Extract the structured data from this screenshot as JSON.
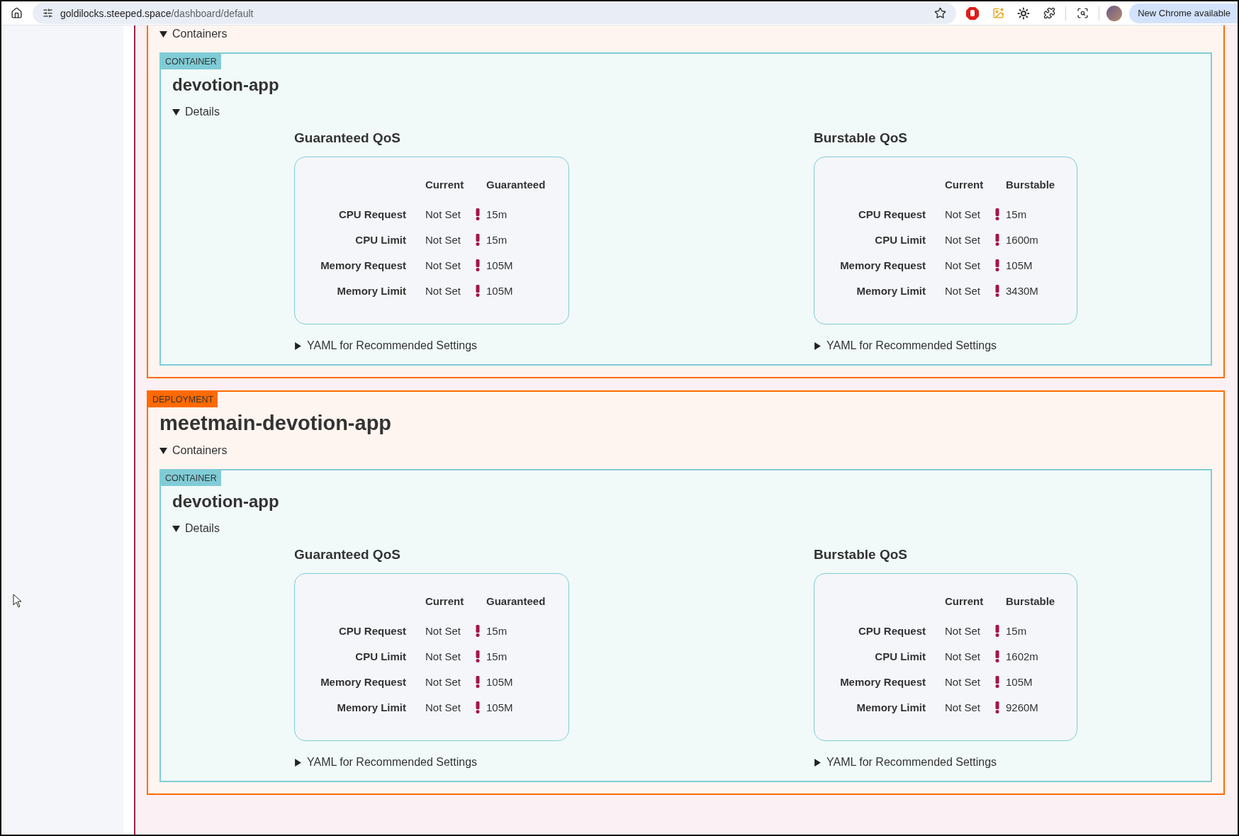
{
  "browser": {
    "url_host": "goldilocks.steeped.space",
    "url_path": "/dashboard/default",
    "update_label": "New Chrome available"
  },
  "deployments": [
    {
      "containers_toggle": {
        "label": "Containers",
        "expanded": true
      },
      "containers": [
        {
          "badge": "CONTAINER",
          "name": "devotion-app",
          "details_toggle": {
            "label": "Details",
            "expanded": true
          },
          "qos": [
            {
              "title": "Guaranteed QoS",
              "headers": [
                "Current",
                "Guaranteed"
              ],
              "rows": [
                {
                  "label": "CPU Request",
                  "current": "Not Set",
                  "warning": true,
                  "value": "15m"
                },
                {
                  "label": "CPU Limit",
                  "current": "Not Set",
                  "warning": true,
                  "value": "15m"
                },
                {
                  "label": "Memory Request",
                  "current": "Not Set",
                  "warning": true,
                  "value": "105M"
                },
                {
                  "label": "Memory Limit",
                  "current": "Not Set",
                  "warning": true,
                  "value": "105M"
                }
              ],
              "yaml_toggle": {
                "label": "YAML for Recommended Settings",
                "expanded": false
              }
            },
            {
              "title": "Burstable QoS",
              "headers": [
                "Current",
                "Burstable"
              ],
              "rows": [
                {
                  "label": "CPU Request",
                  "current": "Not Set",
                  "warning": true,
                  "value": "15m"
                },
                {
                  "label": "CPU Limit",
                  "current": "Not Set",
                  "warning": true,
                  "value": "1600m"
                },
                {
                  "label": "Memory Request",
                  "current": "Not Set",
                  "warning": true,
                  "value": "105M"
                },
                {
                  "label": "Memory Limit",
                  "current": "Not Set",
                  "warning": true,
                  "value": "3430M"
                }
              ],
              "yaml_toggle": {
                "label": "YAML for Recommended Settings",
                "expanded": false
              }
            }
          ]
        }
      ]
    },
    {
      "badge": "DEPLOYMENT",
      "name": "meetmain-devotion-app",
      "containers_toggle": {
        "label": "Containers",
        "expanded": true
      },
      "containers": [
        {
          "badge": "CONTAINER",
          "name": "devotion-app",
          "details_toggle": {
            "label": "Details",
            "expanded": true
          },
          "qos": [
            {
              "title": "Guaranteed QoS",
              "headers": [
                "Current",
                "Guaranteed"
              ],
              "rows": [
                {
                  "label": "CPU Request",
                  "current": "Not Set",
                  "warning": true,
                  "value": "15m"
                },
                {
                  "label": "CPU Limit",
                  "current": "Not Set",
                  "warning": true,
                  "value": "15m"
                },
                {
                  "label": "Memory Request",
                  "current": "Not Set",
                  "warning": true,
                  "value": "105M"
                },
                {
                  "label": "Memory Limit",
                  "current": "Not Set",
                  "warning": true,
                  "value": "105M"
                }
              ],
              "yaml_toggle": {
                "label": "YAML for Recommended Settings",
                "expanded": false
              }
            },
            {
              "title": "Burstable QoS",
              "headers": [
                "Current",
                "Burstable"
              ],
              "rows": [
                {
                  "label": "CPU Request",
                  "current": "Not Set",
                  "warning": true,
                  "value": "15m"
                },
                {
                  "label": "CPU Limit",
                  "current": "Not Set",
                  "warning": true,
                  "value": "1602m"
                },
                {
                  "label": "Memory Request",
                  "current": "Not Set",
                  "warning": true,
                  "value": "105M"
                },
                {
                  "label": "Memory Limit",
                  "current": "Not Set",
                  "warning": true,
                  "value": "9260M"
                }
              ],
              "yaml_toggle": {
                "label": "YAML for Recommended Settings",
                "expanded": false
              }
            }
          ]
        }
      ]
    }
  ]
}
